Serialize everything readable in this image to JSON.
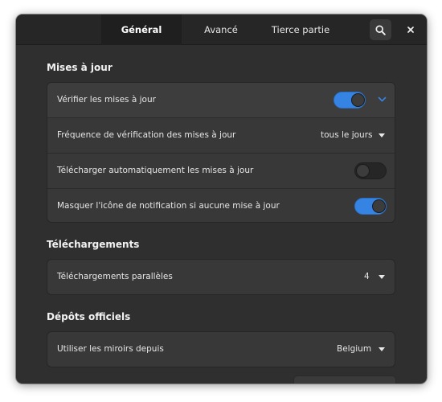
{
  "window": {
    "tabs": [
      {
        "label": "Général",
        "active": true
      },
      {
        "label": "Avancé",
        "active": false
      },
      {
        "label": "Tierce partie",
        "active": false
      }
    ],
    "search_icon": "search-icon",
    "close_icon": "close-icon",
    "accent_color": "#3584e4"
  },
  "updates": {
    "title": "Mises à jour",
    "check_updates": {
      "label": "Vérifier les mises à jour",
      "enabled": true,
      "expander_icon": "chevron-down-icon"
    },
    "frequency": {
      "label": "Fréquence de vérification des mises à jour",
      "value": "tous le jours"
    },
    "auto_download": {
      "label": "Télécharger automatiquement les mises à jour",
      "enabled": false
    },
    "hide_icon": {
      "label": "Masquer l'icône de notification si aucune mise à jour",
      "enabled": true
    }
  },
  "downloads": {
    "title": "Téléchargements",
    "parallel": {
      "label": "Téléchargements parallèles",
      "value": "4"
    }
  },
  "repos": {
    "title": "Dépôts officiels",
    "mirrors": {
      "label": "Utiliser les miroirs depuis",
      "value": "Belgium"
    }
  }
}
